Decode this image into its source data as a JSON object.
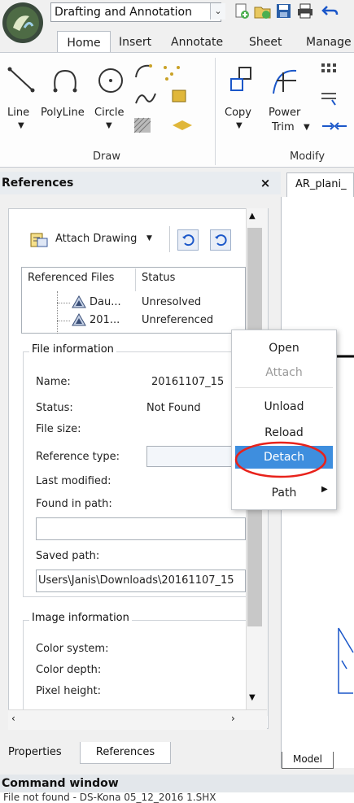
{
  "app": {
    "workspace": "Drafting and Annotation"
  },
  "quick_access": [
    "new-icon",
    "open-icon",
    "save-icon",
    "print-icon",
    "undo-icon"
  ],
  "ribbon": {
    "tabs": [
      "Home",
      "Insert",
      "Annotate",
      "Sheet",
      "Manage"
    ],
    "active_tab": "Home",
    "draw_group": {
      "title": "Draw",
      "tools": [
        "Line",
        "PolyLine",
        "Circle"
      ]
    },
    "modify_group": {
      "title": "Modify",
      "tools": [
        "Copy",
        "Power",
        "Trim"
      ]
    }
  },
  "panel": {
    "title": "References",
    "close": "×",
    "attach_label": "Attach Drawing",
    "table": {
      "headers": [
        "Referenced Files",
        "Status"
      ],
      "rows": [
        {
          "name": "Dau...",
          "status": "Unresolved"
        },
        {
          "name": "201...",
          "status": "Unreferenced"
        }
      ]
    },
    "file_info": {
      "title": "File information",
      "name_label": "Name:",
      "name_value": "20161107_15",
      "status_label": "Status:",
      "status_value": "Not Found",
      "size_label": "File size:",
      "ref_type_label": "Reference type:",
      "modified_label": "Last modified:",
      "found_label": "Found in path:",
      "saved_label": "Saved path:",
      "saved_value": "Users\\Janis\\Downloads\\20161107_15"
    },
    "image_info": {
      "title": "Image information",
      "color_system": "Color system:",
      "color_depth": "Color depth:",
      "pixel_height": "Pixel height:"
    }
  },
  "bottom_tabs": [
    "Properties",
    "References"
  ],
  "command": {
    "title": "Command window",
    "line": "File not found - DS-Kona 05_12_2016 1.SHX"
  },
  "canvas": {
    "doc_tab": "AR_plani_",
    "model_tab": "Model"
  },
  "context_menu": {
    "items": [
      "Open",
      "Attach",
      "Unload",
      "Reload",
      "Detach",
      "Path"
    ],
    "disabled": [
      "Attach"
    ],
    "highlighted": "Detach",
    "submenu_arrow": "▶"
  },
  "colors": {
    "highlight": "#3e8ede",
    "annotation_circle": "#e8221b",
    "accent_blue": "#1b57c9"
  }
}
